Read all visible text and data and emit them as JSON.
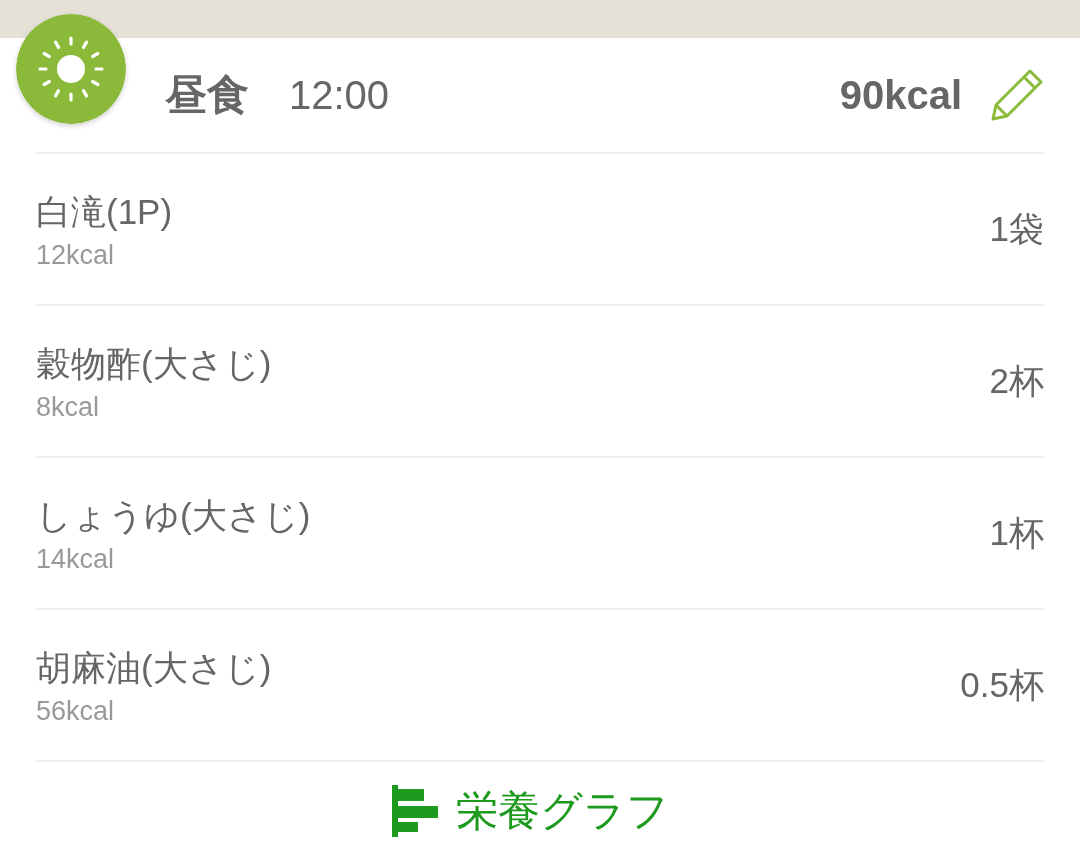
{
  "header": {
    "meal": "昼食",
    "time": "12:00",
    "total": "90kcal"
  },
  "items": [
    {
      "name": "白滝(1P)",
      "kcal": "12kcal",
      "quantity": "1袋"
    },
    {
      "name": "穀物酢(大さじ)",
      "kcal": "8kcal",
      "quantity": "2杯"
    },
    {
      "name": "しょうゆ(大さじ)",
      "kcal": "14kcal",
      "quantity": "1杯"
    },
    {
      "name": "胡麻油(大さじ)",
      "kcal": "56kcal",
      "quantity": "0.5杯"
    }
  ],
  "footer": {
    "link": "栄養グラフ"
  }
}
